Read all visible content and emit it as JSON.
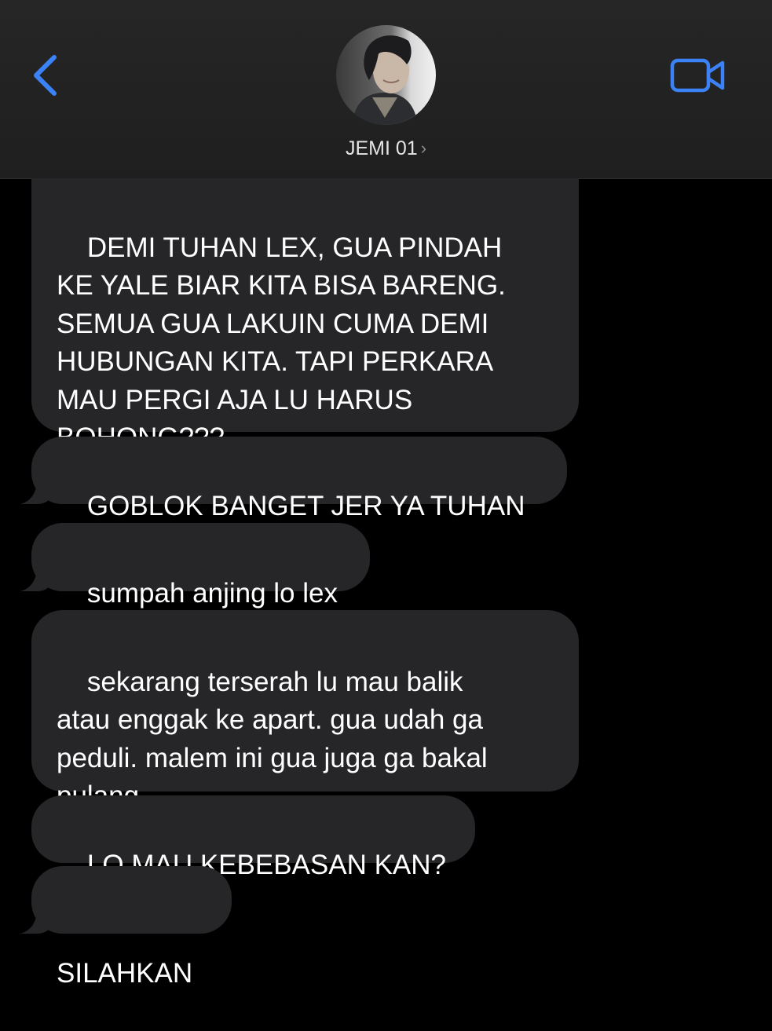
{
  "header": {
    "contact_name": "JEMI 01",
    "chevron": "›",
    "back_icon": "chevron-left-icon",
    "video_icon": "video-camera-icon",
    "accent_color": "#3b82f6"
  },
  "messages": [
    {
      "text": "DEMI TUHAN LEX, GUA PINDAH\nKE YALE BIAR KITA BISA BARENG.\nSEMUA GUA LAKUIN CUMA DEMI\nHUBUNGAN KITA. TAPI PERKARA\nMAU PERGI AJA LU HARUS\nBOHONG???"
    },
    {
      "text": "GOBLOK BANGET JER YA TUHAN"
    },
    {
      "text": "sumpah anjing lo lex"
    },
    {
      "text": "sekarang terserah lu mau balik\natau enggak ke apart. gua udah ga\npeduli. malem ini gua juga ga bakal\npulang"
    },
    {
      "text": "LO MAU KEBEBASAN KAN?"
    },
    {
      "text": "SILAHKAN"
    }
  ]
}
